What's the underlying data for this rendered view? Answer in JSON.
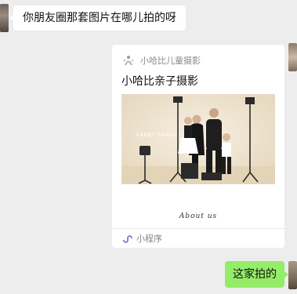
{
  "messages": {
    "incoming_text": "你朋友圈那套图片在哪儿拍的呀",
    "outgoing_text": "这家拍的"
  },
  "mini_program_card": {
    "app_name": "小哈比儿童摄影",
    "title": "小哈比亲子摄影",
    "image_overlay_text": "HABBY FAMILY",
    "caption": "About us",
    "footer_label": "小程序",
    "icons": {
      "app_logo": "habby-logo-icon",
      "footer": "mini-program-icon"
    }
  },
  "colors": {
    "chat_background": "#ededed",
    "incoming_bubble": "#ffffff",
    "outgoing_bubble": "#95ec69",
    "mini_program_icon": "#6b68c9"
  }
}
